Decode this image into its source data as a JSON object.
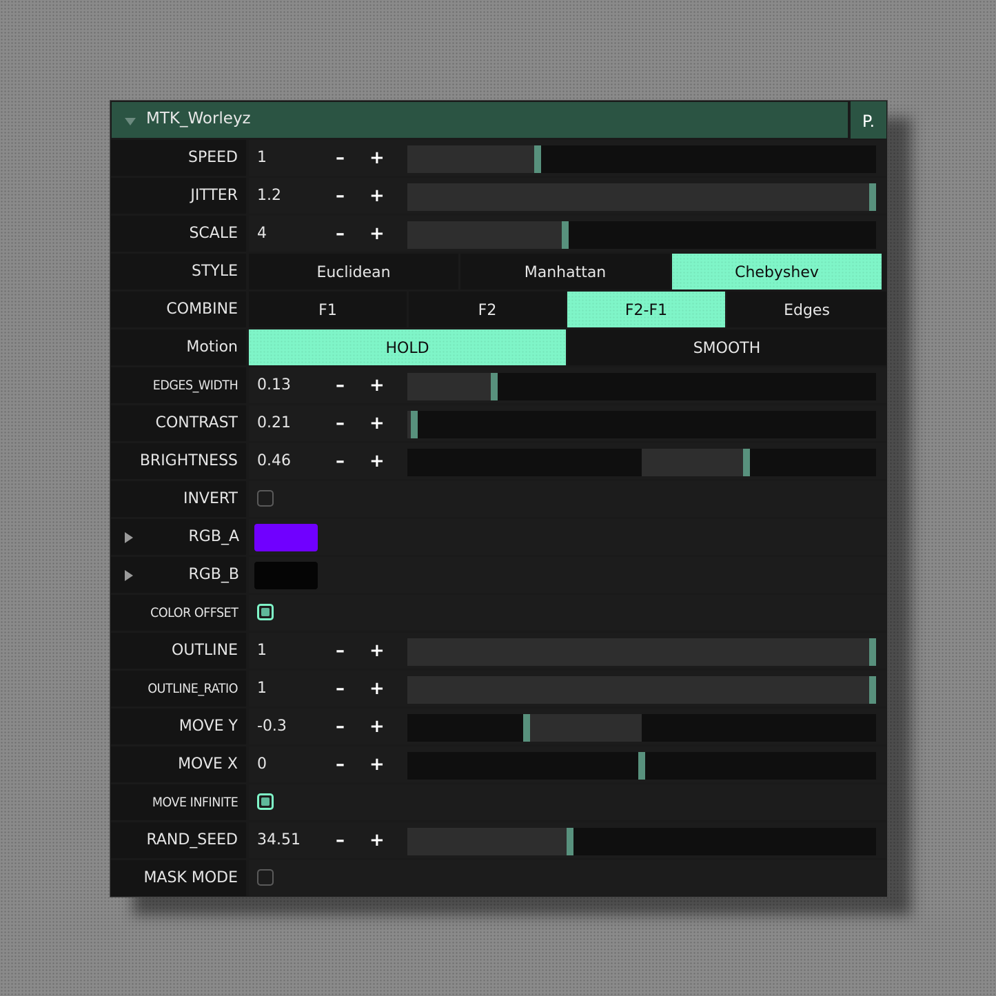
{
  "colors": {
    "accent": "#7ff5c8",
    "knob": "#58917d",
    "header_bg": "#2b5443"
  },
  "header": {
    "title": "MTK_Worleyz",
    "menu_label": "P.",
    "collapse_icon": "triangle-down-icon"
  },
  "rows": {
    "speed": {
      "label": "SPEED",
      "value": "1",
      "minus": "–",
      "plus": "+",
      "slider_pos": 0.275
    },
    "jitter": {
      "label": "JITTER",
      "value": "1.2",
      "minus": "–",
      "plus": "+",
      "slider_pos": 1.0
    },
    "scale": {
      "label": "SCALE",
      "value": "4",
      "minus": "–",
      "plus": "+",
      "slider_pos": 0.335
    },
    "style": {
      "label": "STYLE",
      "options": [
        "Euclidean",
        "Manhattan",
        "Chebyshev"
      ],
      "selected": "Chebyshev"
    },
    "combine": {
      "label": "COMBINE",
      "options": [
        "F1",
        "F2",
        "F2-F1",
        "Edges"
      ],
      "selected": "F2-F1"
    },
    "motion": {
      "label": "Motion",
      "options": [
        "HOLD",
        "SMOOTH"
      ],
      "selected": "HOLD"
    },
    "edges_width": {
      "label": "EDGES_WIDTH",
      "value": "0.13",
      "minus": "–",
      "plus": "+",
      "slider_pos": 0.18
    },
    "contrast": {
      "label": "CONTRAST",
      "value": "0.21",
      "minus": "–",
      "plus": "+",
      "slider_pos": 0.007
    },
    "brightness": {
      "label": "BRIGHTNESS",
      "value": "0.46",
      "minus": "–",
      "plus": "+",
      "slider_pos": 0.727,
      "fill_from": 0.5
    },
    "invert": {
      "label": "INVERT",
      "checked": false
    },
    "rgb_a": {
      "label": "RGB_A",
      "color": "#7000ff",
      "expand_icon": "triangle-right-icon"
    },
    "rgb_b": {
      "label": "RGB_B",
      "color": "#050505",
      "expand_icon": "triangle-right-icon"
    },
    "color_offset": {
      "label": "COLOR OFFSET",
      "checked": true
    },
    "outline": {
      "label": "OUTLINE",
      "value": "1",
      "minus": "–",
      "plus": "+",
      "slider_pos": 1.0
    },
    "outline_ratio": {
      "label": "OUTLINE_RATIO",
      "value": "1",
      "minus": "–",
      "plus": "+",
      "slider_pos": 1.0
    },
    "move_y": {
      "label": "MOVE Y",
      "value": "-0.3",
      "minus": "–",
      "plus": "+",
      "slider_pos": 0.25,
      "fill_from": 0.5
    },
    "move_x": {
      "label": "MOVE X",
      "value": "0",
      "minus": "–",
      "plus": "+",
      "slider_pos": 0.5,
      "fill_from": 0.5
    },
    "move_infinite": {
      "label": "MOVE INFINITE",
      "checked": true
    },
    "rand_seed": {
      "label": "RAND_SEED",
      "value": "34.51",
      "minus": "–",
      "plus": "+",
      "slider_pos": 0.345
    },
    "mask_mode": {
      "label": "MASK MODE",
      "checked": false
    }
  }
}
